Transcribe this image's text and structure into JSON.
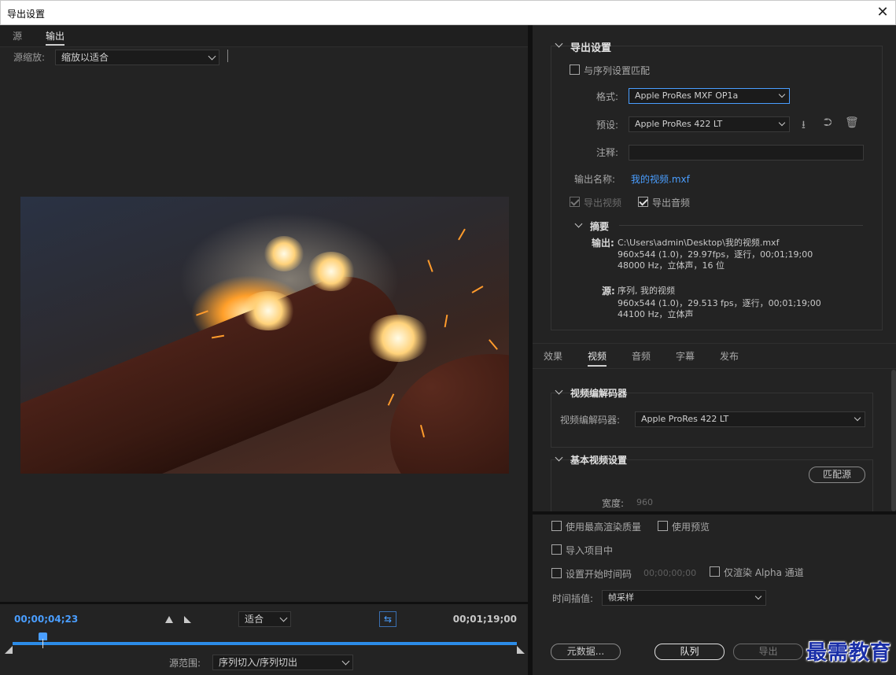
{
  "window": {
    "title": "导出设置",
    "close_glyph": "✕"
  },
  "left": {
    "tabs": [
      "源",
      "输出"
    ],
    "source_zoom_label": "源缩放:",
    "source_zoom_value": "缩放以适合",
    "timecode_current": "00;00;04;23",
    "timecode_end": "00;01;19;00",
    "fit_value": "适合",
    "fit_icon": "⇆",
    "source_range_label": "源范围:",
    "source_range_value": "序列切入/序列切出"
  },
  "export_settings": {
    "header": "导出设置",
    "match_sequence": "与序列设置匹配",
    "format_label": "格式:",
    "format_value": "Apple ProRes MXF OP1a",
    "preset_label": "预设:",
    "preset_value": "Apple ProRes 422 LT",
    "comment_label": "注释:",
    "output_name_label": "输出名称:",
    "output_name_value": "我的视频.mxf",
    "export_video": "导出视频",
    "export_audio": "导出音频",
    "summary": {
      "header": "摘要",
      "output_label": "输出:",
      "output_lines": [
        "C:\\Users\\admin\\Desktop\\我的视频.mxf",
        "960x544 (1.0)，29.97fps，逐行，00;01;19;00",
        "48000 Hz，立体声，16 位"
      ],
      "source_label": "源:",
      "source_lines": [
        "序列, 我的视频",
        "960x544 (1.0)，29.513 fps，逐行，00;01;19;00",
        "44100 Hz，立体声"
      ]
    }
  },
  "tabs": [
    "效果",
    "视频",
    "音频",
    "字幕",
    "发布"
  ],
  "video_codec": {
    "header": "视频编解码器",
    "label": "视频编解码器:",
    "value": "Apple ProRes 422 LT"
  },
  "basic_video": {
    "header": "基本视频设置",
    "match_source": "匹配源",
    "width_label": "宽度:",
    "width_value": "960"
  },
  "bottom": {
    "max_render_quality": "使用最高渲染质量",
    "use_previews": "使用预览",
    "import_into_project": "导入项目中",
    "set_start_timecode": "设置开始时间码",
    "start_timecode_value": "00;00;00;00",
    "render_alpha_only": "仅渲染 Alpha 通道",
    "time_interpolation_label": "时间插值:",
    "time_interpolation_value": "帧采样",
    "metadata_button": "元数据...",
    "queue_button": "队列",
    "export_button": "导出"
  },
  "watermark": "最需教育"
}
